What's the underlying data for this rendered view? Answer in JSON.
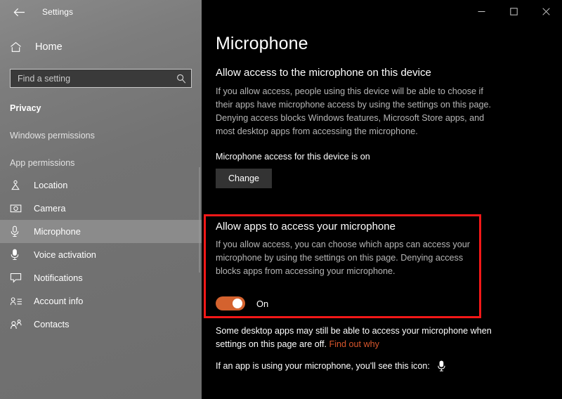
{
  "window": {
    "title": "Settings",
    "back_icon": "back-arrow-icon",
    "controls": [
      {
        "name": "minimize",
        "glyph": "minimize-icon"
      },
      {
        "name": "maximize",
        "glyph": "maximize-icon"
      },
      {
        "name": "close",
        "glyph": "close-icon"
      }
    ]
  },
  "sidebar": {
    "home": {
      "label": "Home",
      "icon": "home-icon"
    },
    "search": {
      "placeholder": "Find a setting",
      "value": "",
      "icon": "search-icon"
    },
    "section_header": "Privacy",
    "groups": [
      {
        "label": "Windows permissions"
      },
      {
        "label": "App permissions"
      }
    ],
    "items": [
      {
        "label": "Location",
        "icon": "location-pin-person-icon",
        "selected": false
      },
      {
        "label": "Camera",
        "icon": "camera-icon",
        "selected": false
      },
      {
        "label": "Microphone",
        "icon": "microphone-icon",
        "selected": true
      },
      {
        "label": "Voice activation",
        "icon": "voice-activation-microphone-icon",
        "selected": false
      },
      {
        "label": "Notifications",
        "icon": "notification-balloon-icon",
        "selected": false
      },
      {
        "label": "Account info",
        "icon": "account-info-icon",
        "selected": false
      },
      {
        "label": "Contacts",
        "icon": "contacts-people-icon",
        "selected": false
      }
    ]
  },
  "main": {
    "page_title": "Microphone",
    "device_section": {
      "heading": "Allow access to the microphone on this device",
      "description": "If you allow access, people using this device will be able to choose if their apps have microphone access by using the settings on this page. Denying access blocks Windows features, Microsoft Store apps, and most desktop apps from accessing the microphone.",
      "status": "Microphone access for this device is on",
      "change_button": "Change"
    },
    "apps_section": {
      "heading": "Allow apps to access your microphone",
      "description": "If you allow access, you can choose which apps can access your microphone by using the settings on this page. Denying access blocks apps from accessing your microphone.",
      "toggle_state": "On",
      "highlighted": true
    },
    "footer": {
      "desktop_note_before": "Some desktop apps may still be able to access your microphone when settings on this page are off.",
      "desktop_note_link": "Find out why",
      "icon_note": "If an app is using your microphone, you'll see this icon:",
      "icon_name": "microphone-icon"
    }
  },
  "colors": {
    "sidebar_bg": "#727272",
    "content_bg": "#000000",
    "accent_toggle": "#d4622e",
    "highlight_box": "#f51818",
    "link": "#d8562c",
    "selected_row": "#8b8b8b"
  }
}
